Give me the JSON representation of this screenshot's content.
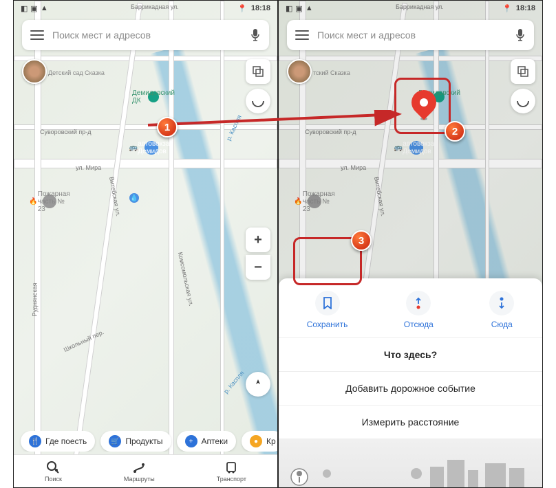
{
  "status": {
    "time": "18:18"
  },
  "search": {
    "placeholder": "Поиск мест и адресов"
  },
  "map": {
    "street_mira": "ул. Мира",
    "street_suvorov": "Суворовский пр-д",
    "street_barrikad": "Баррикадная ул.",
    "street_vitebsk": "Витебская ул.",
    "street_rudnya": "Руднянская",
    "street_komsomol": "Комсомольская ул.",
    "street_shkolny": "Школьный пер.",
    "river": "р. Каспля",
    "poi_bus": "автовокзал Демидов",
    "poi_dk": "Демидовский ДК",
    "poi_fire": "Пожарная часть № 23",
    "poi_skazka": "тский Сказка",
    "poi_skazka_full": "Детский сад Сказка"
  },
  "chips": {
    "food": "Где поесть",
    "products": "Продукты",
    "pharmacy": "Аптеки",
    "more": "Кр"
  },
  "nav": {
    "search": "Поиск",
    "routes": "Маршруты",
    "transport": "Транспорт"
  },
  "sheet": {
    "save": "Сохранить",
    "from": "Отсюда",
    "to": "Сюда",
    "what": "Что здесь?",
    "event": "Добавить дорожное событие",
    "measure": "Измерить расстояние"
  },
  "badges": {
    "b1": "1",
    "b2": "2",
    "b3": "3"
  }
}
